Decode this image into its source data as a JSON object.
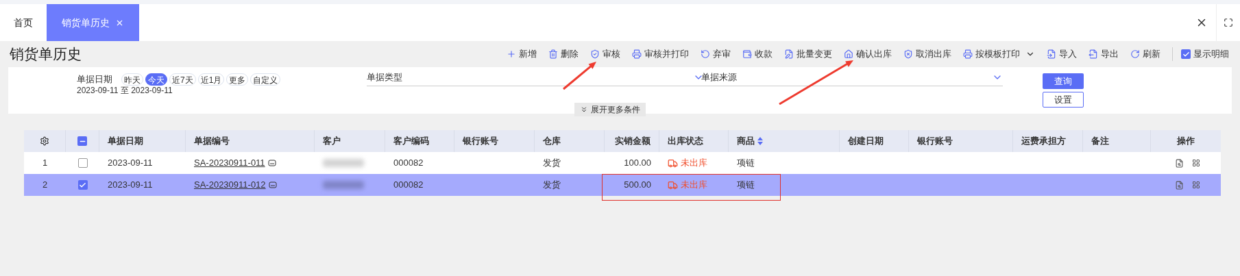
{
  "tabs": [
    {
      "label": "首页",
      "selected": false,
      "closable": false
    },
    {
      "label": "销货单历史",
      "selected": true,
      "closable": true
    }
  ],
  "page_title": "销货单历史",
  "toolbar": [
    {
      "label": "新增",
      "kind": "button"
    },
    {
      "label": "删除",
      "kind": "button"
    },
    {
      "label": "审核",
      "kind": "button"
    },
    {
      "label": "审核并打印",
      "kind": "button"
    },
    {
      "label": "弃审",
      "kind": "button"
    },
    {
      "label": "收款",
      "kind": "button"
    },
    {
      "label": "批量变更",
      "kind": "button"
    },
    {
      "label": "确认出库",
      "kind": "button"
    },
    {
      "label": "取消出库",
      "kind": "button"
    },
    {
      "label": "按模板打印",
      "kind": "dropdown"
    },
    {
      "label": "导入",
      "kind": "button"
    },
    {
      "label": "导出",
      "kind": "button"
    },
    {
      "label": "刷新",
      "kind": "button"
    },
    {
      "label": "显示明细",
      "kind": "checkbox",
      "checked": true
    }
  ],
  "filters": {
    "date": {
      "label": "单据日期",
      "options": [
        {
          "label": "昨天",
          "selected": false
        },
        {
          "label": "今天",
          "selected": true
        },
        {
          "label": "近7天",
          "selected": false
        },
        {
          "label": "近1月",
          "selected": false
        },
        {
          "label": "更多",
          "selected": false
        },
        {
          "label": "自定义",
          "selected": false
        }
      ],
      "range": "2023-09-11 至 2023-09-11"
    },
    "selects": [
      {
        "label": "单据类型"
      },
      {
        "label": "单据来源"
      }
    ],
    "expand": "展开更多条件",
    "query": "查询",
    "settings": "设置"
  },
  "table": {
    "select_all": {
      "checked": true,
      "indeterminate": true
    },
    "columns": [
      {
        "label": "单据日期",
        "sorted": false
      },
      {
        "label": "单据编号",
        "sorted": false
      },
      {
        "label": "客户",
        "sorted": false
      },
      {
        "label": "客户编码",
        "sorted": false
      },
      {
        "label": "银行账号",
        "sorted": false
      },
      {
        "label": "仓库",
        "sorted": false
      },
      {
        "label": "实销金额",
        "sorted": false
      },
      {
        "label": "出库状态",
        "sorted": false
      },
      {
        "label": "商品",
        "sorted": true
      },
      {
        "label": "创建日期",
        "sorted": false
      },
      {
        "label": "银行账号",
        "sorted": false
      },
      {
        "label": "运费承担方",
        "sorted": false
      },
      {
        "label": "备注",
        "sorted": false
      }
    ],
    "actions_header": "操作",
    "rows": [
      {
        "index": "1",
        "checked": false,
        "selected": false,
        "date": "2023-09-11",
        "number": "SA-20230911-011",
        "customer_code": "000082",
        "warehouse": "发货",
        "amount": "100.00",
        "status": "未出库",
        "product": "项链"
      },
      {
        "index": "2",
        "checked": true,
        "selected": true,
        "date": "2023-09-11",
        "number": "SA-20230911-012",
        "customer_code": "000082",
        "warehouse": "发货",
        "amount": "500.00",
        "status": "未出库",
        "product": "项链"
      }
    ]
  },
  "annotations": [
    {
      "kind": "arrow"
    },
    {
      "kind": "arrow"
    },
    {
      "kind": "box"
    }
  ]
}
